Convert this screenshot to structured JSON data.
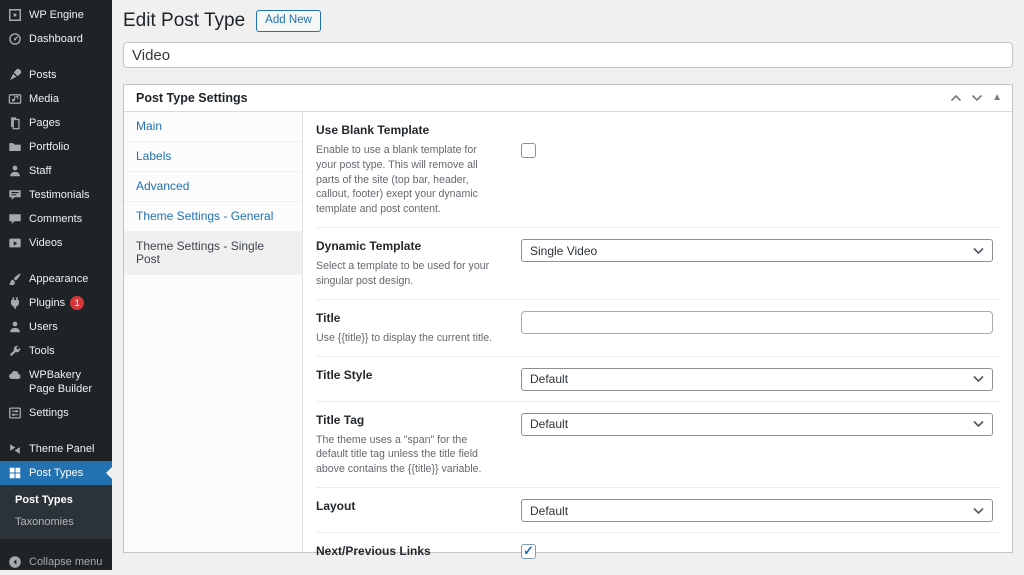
{
  "colors": {
    "accent": "#2271b1",
    "sidebar_bg": "#1d2327",
    "submenu_bg": "#2c3338",
    "badge_red": "#d63638",
    "content_bg": "#f0f0f1"
  },
  "sidebar": {
    "items": [
      {
        "label": "WP Engine",
        "icon": "wpengine-icon"
      },
      {
        "label": "Dashboard",
        "icon": "dashboard-icon"
      },
      {
        "separator": true
      },
      {
        "label": "Posts",
        "icon": "pin-icon"
      },
      {
        "label": "Media",
        "icon": "media-icon"
      },
      {
        "label": "Pages",
        "icon": "pages-icon"
      },
      {
        "label": "Portfolio",
        "icon": "portfolio-icon"
      },
      {
        "label": "Staff",
        "icon": "user-icon"
      },
      {
        "label": "Testimonials",
        "icon": "testimonial-icon"
      },
      {
        "label": "Comments",
        "icon": "comment-icon"
      },
      {
        "label": "Videos",
        "icon": "video-icon"
      },
      {
        "separator": true
      },
      {
        "label": "Appearance",
        "icon": "brush-icon"
      },
      {
        "label": "Plugins",
        "icon": "plugin-icon",
        "badge": "1"
      },
      {
        "label": "Users",
        "icon": "user-icon"
      },
      {
        "label": "Tools",
        "icon": "wrench-icon"
      },
      {
        "label": "WPBakery Page Builder",
        "icon": "cloud-icon"
      },
      {
        "label": "Settings",
        "icon": "settings-icon"
      },
      {
        "separator": true
      },
      {
        "label": "Theme Panel",
        "icon": "theme-panel-icon"
      },
      {
        "label": "Post Types",
        "icon": "grid-icon",
        "active": true
      }
    ],
    "submenu": {
      "items": [
        {
          "label": "Post Types",
          "current": true
        },
        {
          "label": "Taxonomies",
          "current": false
        }
      ]
    },
    "collapse": {
      "label": "Collapse menu",
      "icon": "collapse-icon"
    }
  },
  "header": {
    "title": "Edit Post Type",
    "add_new_label": "Add New"
  },
  "title_input": {
    "value": "Video"
  },
  "metabox": {
    "title": "Post Type Settings",
    "tabs": [
      {
        "label": "Main",
        "active": false
      },
      {
        "label": "Labels",
        "active": false
      },
      {
        "label": "Advanced",
        "active": false
      },
      {
        "label": "Theme Settings - General",
        "active": false
      },
      {
        "label": "Theme Settings - Single Post",
        "active": true
      }
    ],
    "fields": [
      {
        "id": "use-blank-template",
        "label": "Use Blank Template",
        "description": "Enable to use a blank template for your post type. This will remove all parts of the site (top bar, header, callout, footer) exept your dynamic template and post content.",
        "control": {
          "type": "checkbox",
          "checked": false
        }
      },
      {
        "id": "dynamic-template",
        "label": "Dynamic Template",
        "description": "Select a template to be used for your singular post design.",
        "control": {
          "type": "select",
          "value": "Single Video"
        }
      },
      {
        "id": "title",
        "label": "Title",
        "description": "Use {{title}} to display the current title.",
        "control": {
          "type": "text",
          "value": ""
        }
      },
      {
        "id": "title-style",
        "label": "Title Style",
        "description": "",
        "control": {
          "type": "select",
          "value": "Default"
        }
      },
      {
        "id": "title-tag",
        "label": "Title Tag",
        "description": "The theme uses a \"span\" for the default title tag unless the title field above contains the {{title}} variable.",
        "control": {
          "type": "select",
          "value": "Default"
        }
      },
      {
        "id": "layout",
        "label": "Layout",
        "description": "",
        "control": {
          "type": "select",
          "value": "Default"
        }
      },
      {
        "id": "next-previous-links",
        "label": "Next/Previous Links",
        "description": "",
        "control": {
          "type": "checkbox",
          "checked": true
        }
      }
    ]
  }
}
